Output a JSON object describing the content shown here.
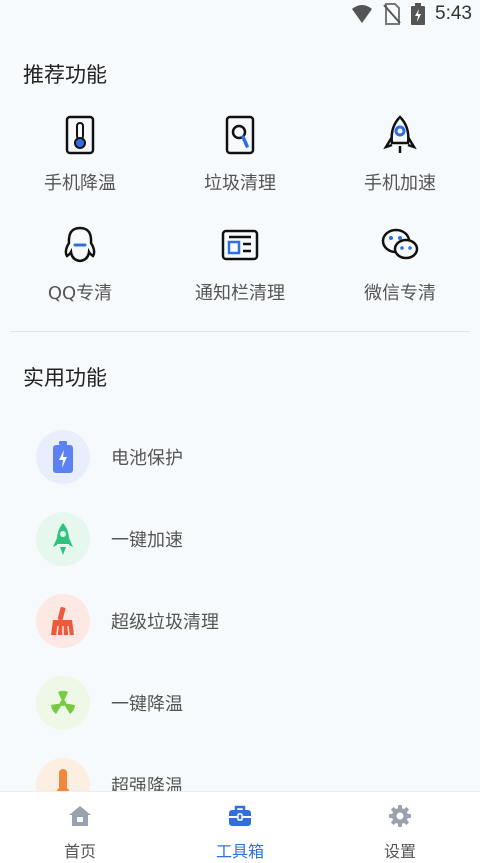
{
  "status": {
    "time": "5:43"
  },
  "recommended": {
    "title": "推荐功能",
    "items": [
      {
        "label": "手机降温",
        "icon": "thermometer-icon"
      },
      {
        "label": "垃圾清理",
        "icon": "trash-scan-icon"
      },
      {
        "label": "手机加速",
        "icon": "rocket-icon"
      },
      {
        "label": "QQ专清",
        "icon": "qq-penguin-icon"
      },
      {
        "label": "通知栏清理",
        "icon": "notification-card-icon"
      },
      {
        "label": "微信专清",
        "icon": "wechat-icon"
      }
    ]
  },
  "practical": {
    "title": "实用功能",
    "items": [
      {
        "label": "电池保护",
        "icon": "battery-icon",
        "color": "#5b82f0"
      },
      {
        "label": "一键加速",
        "icon": "rocket-icon",
        "color": "#2ec27e"
      },
      {
        "label": "超级垃圾清理",
        "icon": "broom-icon",
        "color": "#f05a3c"
      },
      {
        "label": "一键降温",
        "icon": "fan-icon",
        "color": "#7ac943"
      },
      {
        "label": "超强降温",
        "icon": "thermometer-icon",
        "color": "#f0873c"
      }
    ]
  },
  "tabs": [
    {
      "label": "首页",
      "icon": "home-icon",
      "active": false
    },
    {
      "label": "工具箱",
      "icon": "toolbox-icon",
      "active": true
    },
    {
      "label": "设置",
      "icon": "gear-icon",
      "active": false
    }
  ],
  "colors": {
    "accent": "#2f6fe0",
    "inactive": "#555555"
  }
}
